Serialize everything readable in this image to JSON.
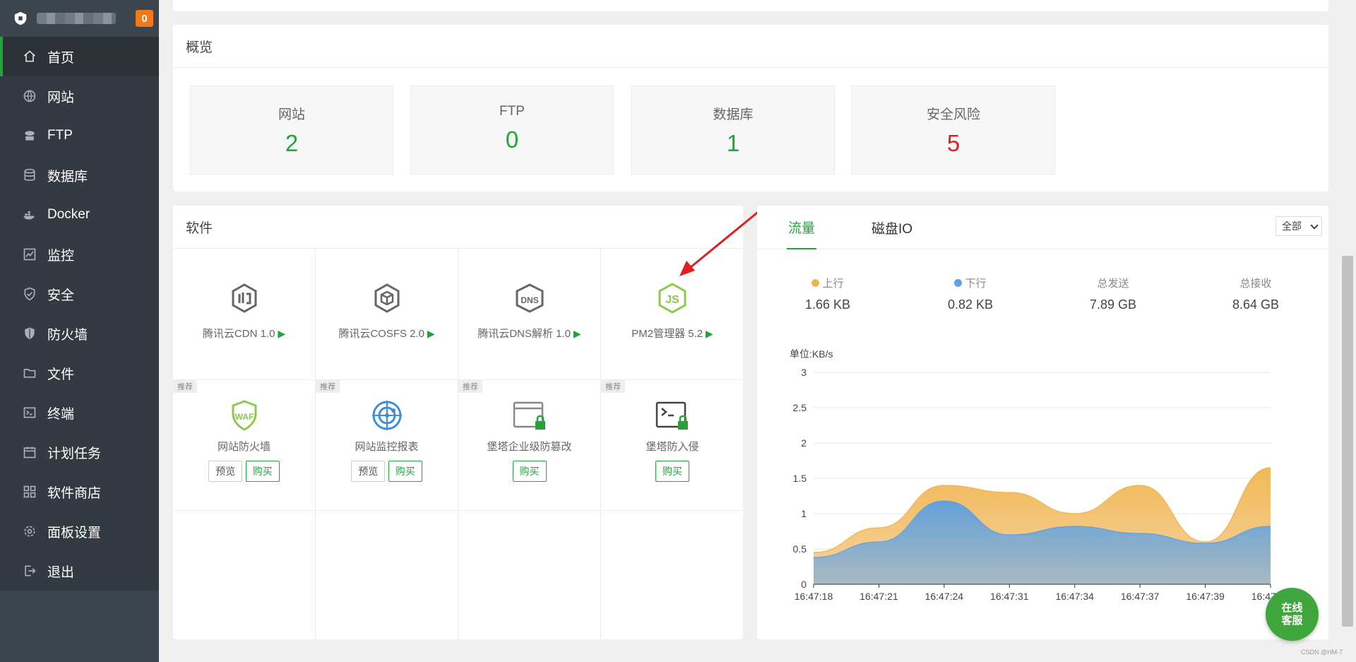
{
  "sidebar": {
    "badge": "0",
    "items": [
      {
        "label": "首页",
        "icon": "home-icon"
      },
      {
        "label": "网站",
        "icon": "globe-icon"
      },
      {
        "label": "FTP",
        "icon": "ftp-icon"
      },
      {
        "label": "数据库",
        "icon": "database-icon"
      },
      {
        "label": "Docker",
        "icon": "docker-icon"
      },
      {
        "label": "监控",
        "icon": "monitor-icon"
      },
      {
        "label": "安全",
        "icon": "shield-check-icon"
      },
      {
        "label": "防火墙",
        "icon": "firewall-shield-icon"
      },
      {
        "label": "文件",
        "icon": "folder-icon"
      },
      {
        "label": "终端",
        "icon": "terminal-icon"
      },
      {
        "label": "计划任务",
        "icon": "calendar-icon"
      },
      {
        "label": "软件商店",
        "icon": "grid-icon"
      },
      {
        "label": "面板设置",
        "icon": "gear-icon"
      },
      {
        "label": "退出",
        "icon": "logout-icon"
      }
    ]
  },
  "overview": {
    "title": "概览",
    "stats": [
      {
        "label": "网站",
        "value": "2"
      },
      {
        "label": "FTP",
        "value": "0"
      },
      {
        "label": "数据库",
        "value": "1"
      },
      {
        "label": "安全风险",
        "value": "5"
      }
    ]
  },
  "software": {
    "title": "软件",
    "installed": [
      {
        "name": "腾讯云CDN 1.0",
        "icon": "tencent-cdn-icon"
      },
      {
        "name": "腾讯云COSFS 2.0",
        "icon": "tencent-cosfs-icon"
      },
      {
        "name": "腾讯云DNS解析 1.0",
        "icon": "dns-icon",
        "icon_text": "DNS"
      },
      {
        "name": "PM2管理器 5.2",
        "icon": "nodejs-icon",
        "icon_text": "JS"
      }
    ],
    "recommended": [
      {
        "tag": "推荐",
        "name": "网站防火墙",
        "icon": "waf-icon",
        "icon_text": "WAF",
        "preview": "预览",
        "buy": "购买"
      },
      {
        "tag": "推荐",
        "name": "网站监控报表",
        "icon": "radar-icon",
        "preview": "预览",
        "buy": "购买"
      },
      {
        "tag": "推荐",
        "name": "堡塔企业级防篡改",
        "icon": "tamper-lock-icon",
        "buy": "购买"
      },
      {
        "tag": "推荐",
        "name": "堡塔防入侵",
        "icon": "terminal-lock-icon",
        "buy": "购买"
      }
    ]
  },
  "traffic": {
    "tabs": [
      "流量",
      "磁盘IO"
    ],
    "select": "全部",
    "metrics": [
      {
        "label": "上行",
        "value": "1.66 KB",
        "color": "#f0b44d"
      },
      {
        "label": "下行",
        "value": "0.82 KB",
        "color": "#5ba2ee"
      },
      {
        "label": "总发送",
        "value": "7.89 GB"
      },
      {
        "label": "总接收",
        "value": "8.64 GB"
      }
    ],
    "unit": "单位:KB/s"
  },
  "chart_data": {
    "type": "area",
    "x": [
      "16:47:18",
      "16:47:21",
      "16:47:24",
      "16:47:31",
      "16:47:34",
      "16:47:37",
      "16:47:39",
      "16:47:41"
    ],
    "series": [
      {
        "name": "上行",
        "color": "#f0b44d",
        "values": [
          0.45,
          0.8,
          1.4,
          1.3,
          1.0,
          1.4,
          0.6,
          1.65
        ]
      },
      {
        "name": "下行",
        "color": "#5ba2ee",
        "values": [
          0.38,
          0.6,
          1.18,
          0.7,
          0.82,
          0.72,
          0.58,
          0.82
        ]
      }
    ],
    "ylim": [
      0,
      3
    ],
    "yticks": [
      "0",
      "0.5",
      "1",
      "1.5",
      "2",
      "2.5",
      "3"
    ],
    "ylabel": "单位:KB/s",
    "grid": true,
    "legend": "none"
  },
  "service_button": "在线客服",
  "watermark": "CSDN @HM-7"
}
